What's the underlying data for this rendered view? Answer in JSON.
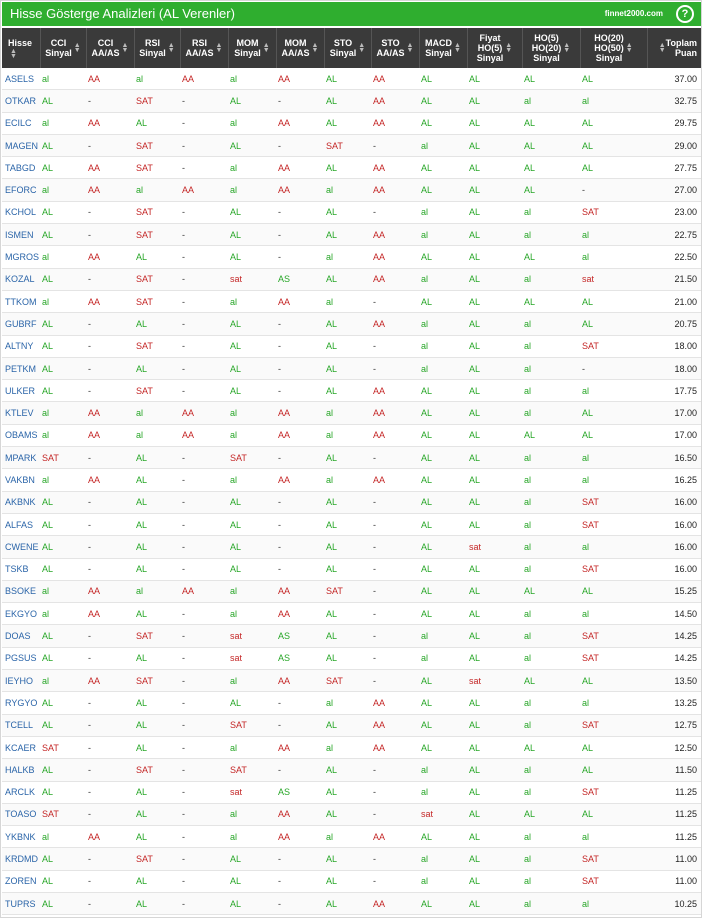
{
  "header": {
    "title": "Hisse Gösterge Analizleri (AL Verenler)",
    "brand": "finnet2000.com",
    "help": "?"
  },
  "columns": [
    [
      "Hisse"
    ],
    [
      "CCI",
      "Sinyal"
    ],
    [
      "CCI",
      "AA/AS"
    ],
    [
      "RSI",
      "Sinyal"
    ],
    [
      "RSI",
      "AA/AS"
    ],
    [
      "MOM",
      "Sinyal"
    ],
    [
      "MOM",
      "AA/AS"
    ],
    [
      "STO",
      "Sinyal"
    ],
    [
      "STO",
      "AA/AS"
    ],
    [
      "MACD",
      "Sinyal"
    ],
    [
      "Fiyat",
      "HO(5)",
      "Sinyal"
    ],
    [
      "HO(5)",
      "HO(20)",
      "Sinyal"
    ],
    [
      "HO(20)",
      "HO(50)",
      "Sinyal"
    ],
    [
      "Toplam",
      "Puan"
    ]
  ],
  "colors": {
    "green": "#27a627",
    "red": "#c42626",
    "header_bg": "#3a3a3a",
    "title_bg": "#2fae2f"
  },
  "rows": [
    [
      "ASELS",
      "al",
      "AA",
      "al",
      "AA",
      "al",
      "AA",
      "AL",
      "AA",
      "AL",
      "AL",
      "AL",
      "AL",
      "37.00"
    ],
    [
      "OTKAR",
      "AL",
      "-",
      "SAT",
      "-",
      "AL",
      "-",
      "AL",
      "AA",
      "AL",
      "AL",
      "al",
      "al",
      "32.75"
    ],
    [
      "ECILC",
      "al",
      "AA",
      "AL",
      "-",
      "al",
      "AA",
      "AL",
      "AA",
      "AL",
      "AL",
      "AL",
      "AL",
      "29.75"
    ],
    [
      "MAGEN",
      "AL",
      "-",
      "SAT",
      "-",
      "AL",
      "-",
      "SAT",
      "-",
      "al",
      "AL",
      "AL",
      "AL",
      "29.00"
    ],
    [
      "TABGD",
      "AL",
      "AA",
      "SAT",
      "-",
      "al",
      "AA",
      "AL",
      "AA",
      "AL",
      "AL",
      "AL",
      "AL",
      "27.75"
    ],
    [
      "EFORC",
      "al",
      "AA",
      "al",
      "AA",
      "al",
      "AA",
      "al",
      "AA",
      "AL",
      "AL",
      "AL",
      "-",
      "27.00"
    ],
    [
      "KCHOL",
      "AL",
      "-",
      "SAT",
      "-",
      "AL",
      "-",
      "AL",
      "-",
      "al",
      "AL",
      "al",
      "SAT",
      "23.00"
    ],
    [
      "ISMEN",
      "AL",
      "-",
      "SAT",
      "-",
      "AL",
      "-",
      "AL",
      "AA",
      "al",
      "AL",
      "al",
      "al",
      "22.75"
    ],
    [
      "MGROS",
      "al",
      "AA",
      "AL",
      "-",
      "AL",
      "-",
      "al",
      "AA",
      "AL",
      "AL",
      "AL",
      "al",
      "22.50"
    ],
    [
      "KOZAL",
      "AL",
      "-",
      "SAT",
      "-",
      "sat",
      "AS",
      "AL",
      "AA",
      "al",
      "AL",
      "al",
      "sat",
      "21.50"
    ],
    [
      "TTKOM",
      "al",
      "AA",
      "SAT",
      "-",
      "al",
      "AA",
      "al",
      "-",
      "AL",
      "AL",
      "AL",
      "AL",
      "21.00"
    ],
    [
      "GUBRF",
      "AL",
      "-",
      "AL",
      "-",
      "AL",
      "-",
      "AL",
      "AA",
      "al",
      "AL",
      "al",
      "AL",
      "20.75"
    ],
    [
      "ALTNY",
      "AL",
      "-",
      "SAT",
      "-",
      "AL",
      "-",
      "AL",
      "-",
      "al",
      "AL",
      "al",
      "SAT",
      "18.00"
    ],
    [
      "PETKM",
      "AL",
      "-",
      "AL",
      "-",
      "AL",
      "-",
      "AL",
      "-",
      "al",
      "AL",
      "al",
      "-",
      "18.00"
    ],
    [
      "ULKER",
      "AL",
      "-",
      "SAT",
      "-",
      "AL",
      "-",
      "AL",
      "AA",
      "AL",
      "AL",
      "al",
      "al",
      "17.75"
    ],
    [
      "KTLEV",
      "al",
      "AA",
      "al",
      "AA",
      "al",
      "AA",
      "al",
      "AA",
      "AL",
      "AL",
      "al",
      "AL",
      "17.00"
    ],
    [
      "OBAMS",
      "al",
      "AA",
      "al",
      "AA",
      "al",
      "AA",
      "al",
      "AA",
      "AL",
      "AL",
      "AL",
      "AL",
      "17.00"
    ],
    [
      "MPARK",
      "SAT",
      "-",
      "AL",
      "-",
      "SAT",
      "-",
      "AL",
      "-",
      "AL",
      "AL",
      "al",
      "al",
      "16.50"
    ],
    [
      "VAKBN",
      "al",
      "AA",
      "AL",
      "-",
      "al",
      "AA",
      "al",
      "AA",
      "AL",
      "AL",
      "al",
      "al",
      "16.25"
    ],
    [
      "AKBNK",
      "AL",
      "-",
      "AL",
      "-",
      "AL",
      "-",
      "AL",
      "-",
      "AL",
      "AL",
      "al",
      "SAT",
      "16.00"
    ],
    [
      "ALFAS",
      "AL",
      "-",
      "AL",
      "-",
      "AL",
      "-",
      "AL",
      "-",
      "AL",
      "AL",
      "al",
      "SAT",
      "16.00"
    ],
    [
      "CWENE",
      "AL",
      "-",
      "AL",
      "-",
      "AL",
      "-",
      "AL",
      "-",
      "AL",
      "sat",
      "al",
      "al",
      "16.00"
    ],
    [
      "TSKB",
      "AL",
      "-",
      "AL",
      "-",
      "AL",
      "-",
      "AL",
      "-",
      "AL",
      "AL",
      "al",
      "SAT",
      "16.00"
    ],
    [
      "BSOKE",
      "al",
      "AA",
      "al",
      "AA",
      "al",
      "AA",
      "SAT",
      "-",
      "AL",
      "AL",
      "AL",
      "AL",
      "15.25"
    ],
    [
      "EKGYO",
      "al",
      "AA",
      "AL",
      "-",
      "al",
      "AA",
      "AL",
      "-",
      "AL",
      "AL",
      "al",
      "al",
      "14.50"
    ],
    [
      "DOAS",
      "AL",
      "-",
      "SAT",
      "-",
      "sat",
      "AS",
      "AL",
      "-",
      "al",
      "AL",
      "al",
      "SAT",
      "14.25"
    ],
    [
      "PGSUS",
      "AL",
      "-",
      "AL",
      "-",
      "sat",
      "AS",
      "AL",
      "-",
      "al",
      "AL",
      "al",
      "SAT",
      "14.25"
    ],
    [
      "IEYHO",
      "al",
      "AA",
      "SAT",
      "-",
      "al",
      "AA",
      "SAT",
      "-",
      "AL",
      "sat",
      "AL",
      "AL",
      "13.50"
    ],
    [
      "RYGYO",
      "AL",
      "-",
      "AL",
      "-",
      "AL",
      "-",
      "al",
      "AA",
      "AL",
      "AL",
      "al",
      "al",
      "13.25"
    ],
    [
      "TCELL",
      "AL",
      "-",
      "AL",
      "-",
      "SAT",
      "-",
      "AL",
      "AA",
      "AL",
      "AL",
      "al",
      "SAT",
      "12.75"
    ],
    [
      "KCAER",
      "SAT",
      "-",
      "AL",
      "-",
      "al",
      "AA",
      "al",
      "AA",
      "AL",
      "AL",
      "AL",
      "AL",
      "12.50"
    ],
    [
      "HALKB",
      "AL",
      "-",
      "SAT",
      "-",
      "SAT",
      "-",
      "AL",
      "-",
      "al",
      "AL",
      "al",
      "AL",
      "11.50"
    ],
    [
      "ARCLK",
      "AL",
      "-",
      "AL",
      "-",
      "sat",
      "AS",
      "AL",
      "-",
      "al",
      "AL",
      "al",
      "SAT",
      "11.25"
    ],
    [
      "TOASO",
      "SAT",
      "-",
      "AL",
      "-",
      "al",
      "AA",
      "AL",
      "-",
      "sat",
      "AL",
      "AL",
      "AL",
      "11.25"
    ],
    [
      "YKBNK",
      "al",
      "AA",
      "AL",
      "-",
      "al",
      "AA",
      "al",
      "AA",
      "AL",
      "AL",
      "al",
      "al",
      "11.25"
    ],
    [
      "KRDMD",
      "AL",
      "-",
      "SAT",
      "-",
      "AL",
      "-",
      "AL",
      "-",
      "al",
      "AL",
      "al",
      "SAT",
      "11.00"
    ],
    [
      "ZOREN",
      "AL",
      "-",
      "AL",
      "-",
      "AL",
      "-",
      "AL",
      "-",
      "al",
      "AL",
      "al",
      "SAT",
      "11.00"
    ],
    [
      "TUPRS",
      "AL",
      "-",
      "AL",
      "-",
      "AL",
      "-",
      "AL",
      "AA",
      "AL",
      "AL",
      "al",
      "al",
      "10.25"
    ]
  ]
}
